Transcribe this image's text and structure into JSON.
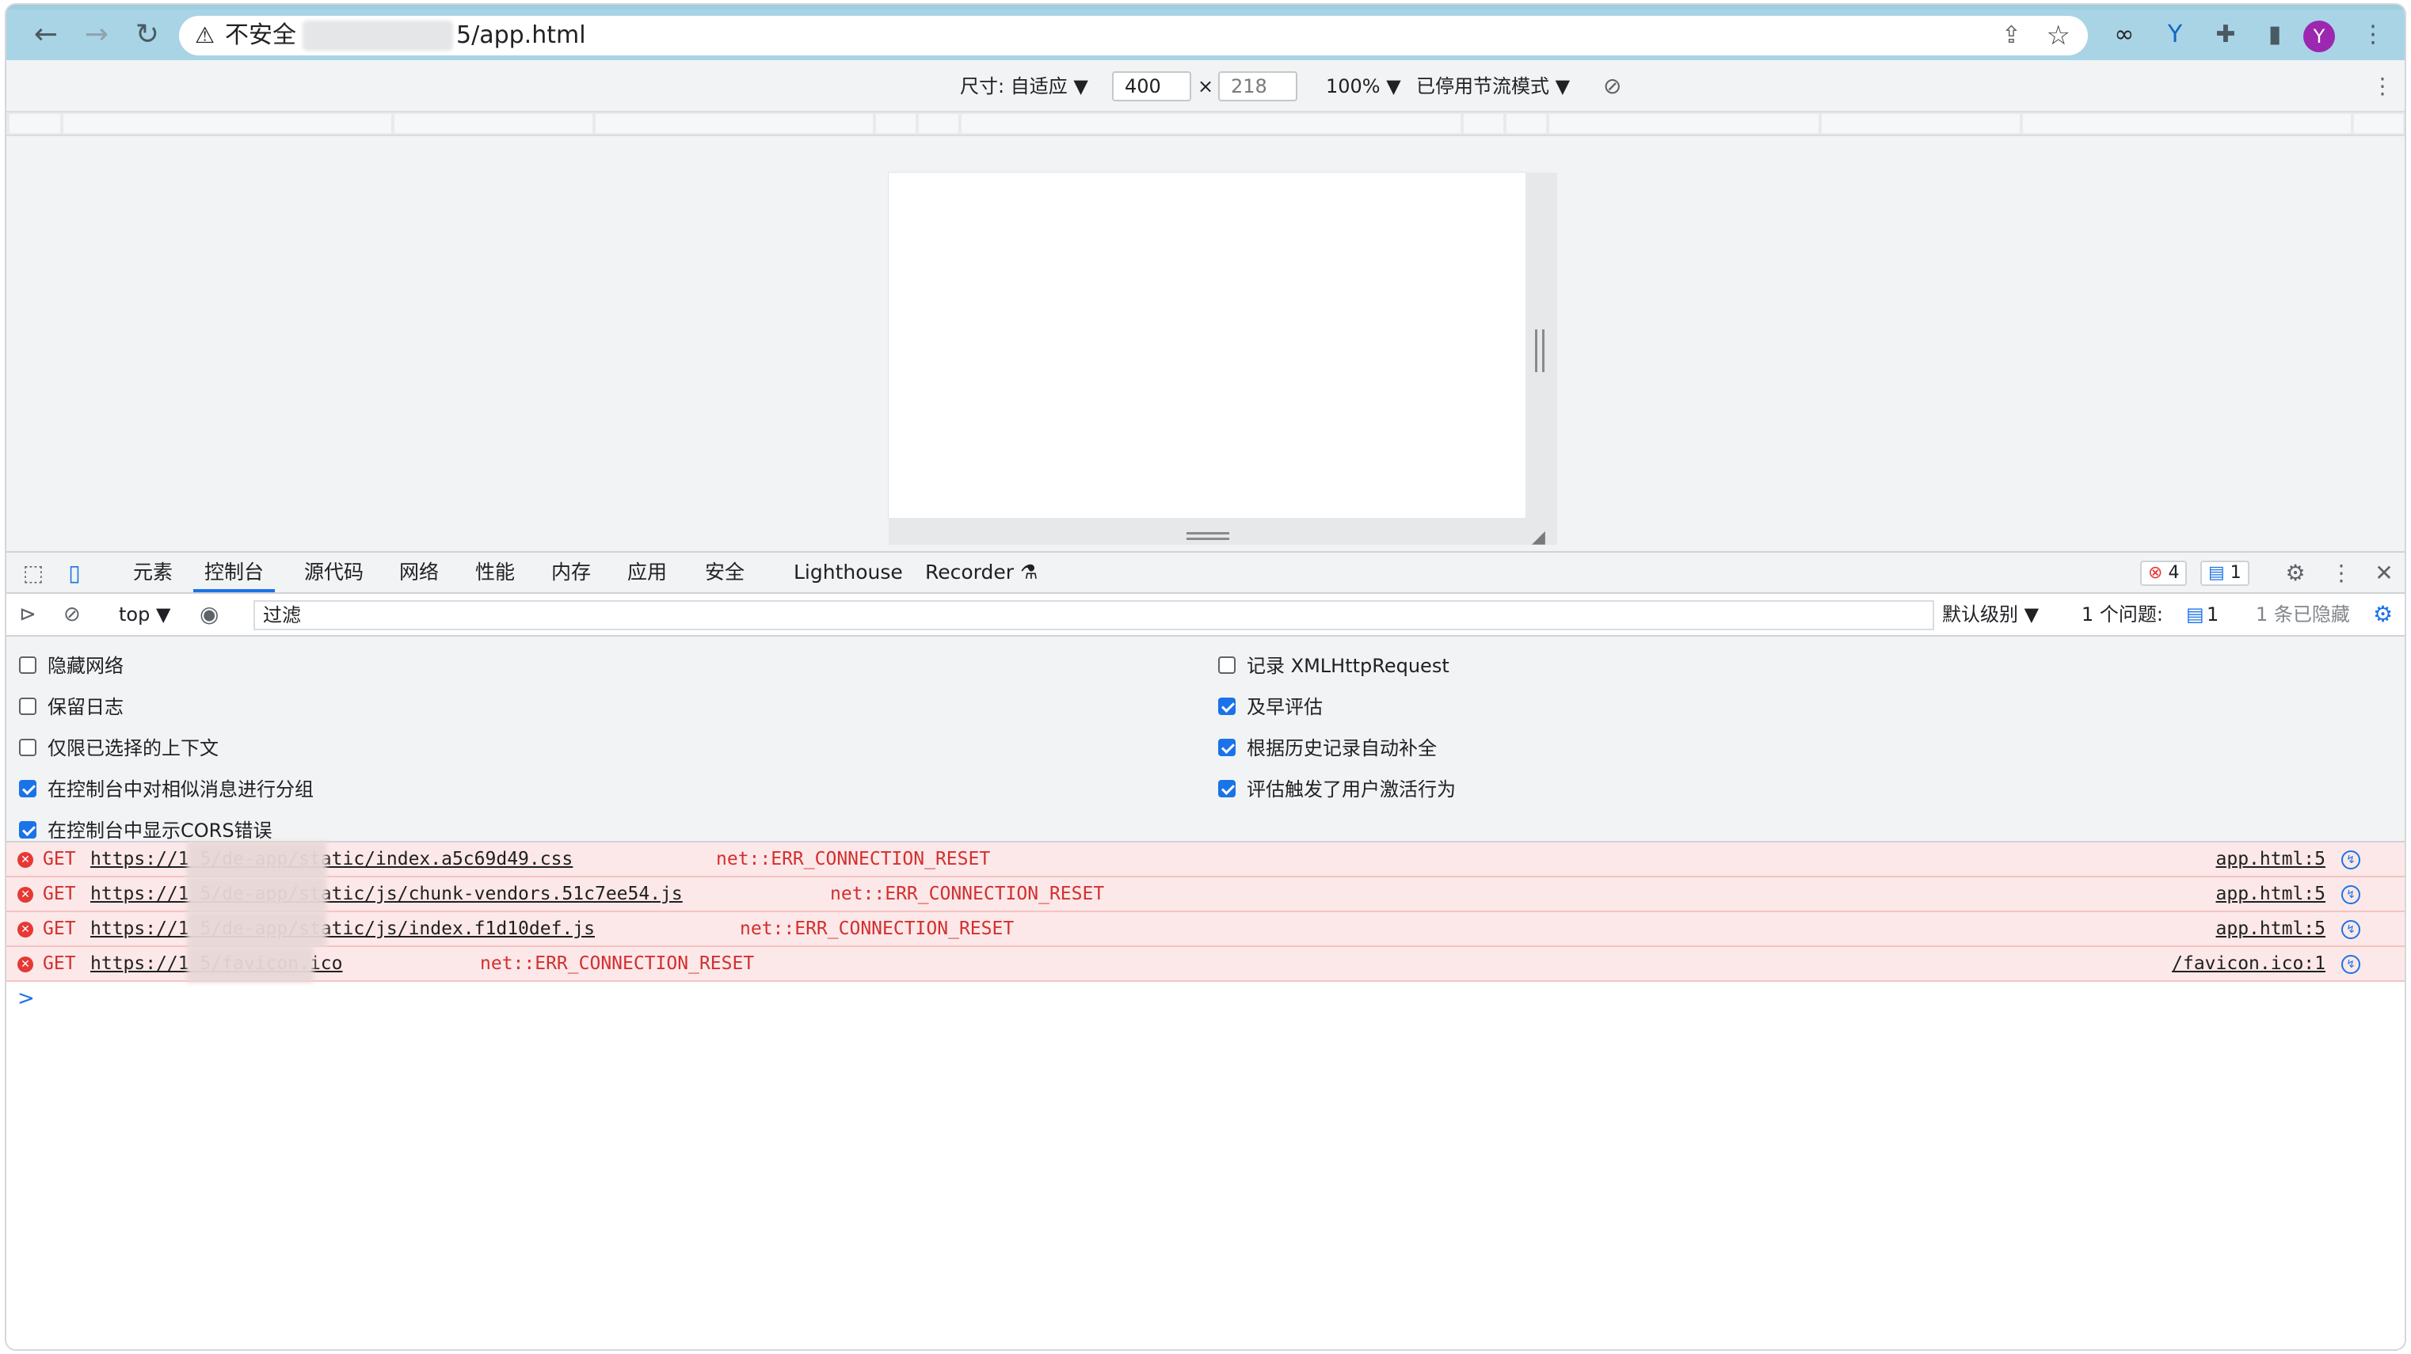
{
  "browser": {
    "security_label": "不安全",
    "url_suffix": "5/app.html",
    "avatar_letter": "Y"
  },
  "device_toolbar": {
    "size_label": "尺寸: 自适应 ▼",
    "width": "400",
    "times": "×",
    "height": "218",
    "zoom": "100% ▼",
    "throttle": "已停用节流模式 ▼"
  },
  "devtools": {
    "tabs": [
      {
        "label": "元素"
      },
      {
        "label": "控制台"
      },
      {
        "label": "源代码"
      },
      {
        "label": "网络"
      },
      {
        "label": "性能"
      },
      {
        "label": "内存"
      },
      {
        "label": "应用"
      },
      {
        "label": "安全"
      },
      {
        "label": "Lighthouse"
      },
      {
        "label": "Recorder ⚗"
      }
    ],
    "active_tab": "控制台",
    "error_count": "4",
    "message_count": "1"
  },
  "console_bar": {
    "context": "top ▼",
    "filter_placeholder": "过滤",
    "level": "默认级别 ▼",
    "issues_label": "1 个问题:",
    "issues_count": "1",
    "hidden_label": "1 条已隐藏"
  },
  "settings": {
    "left": [
      {
        "label": "隐藏网络",
        "checked": false
      },
      {
        "label": "保留日志",
        "checked": false
      },
      {
        "label": "仅限已选择的上下文",
        "checked": false
      },
      {
        "label": "在控制台中对相似消息进行分组",
        "checked": true
      },
      {
        "label": "在控制台中显示CORS错误",
        "checked": true
      }
    ],
    "right": [
      {
        "label": "记录 XMLHttpRequest",
        "checked": false
      },
      {
        "label": "及早评估",
        "checked": true
      },
      {
        "label": "根据历史记录自动补全",
        "checked": true
      },
      {
        "label": "评估触发了用户激活行为",
        "checked": true
      }
    ]
  },
  "errors": [
    {
      "method": "GET",
      "url": "https://1         5/de-app/static/index.a5c69d49.css",
      "code": "net::ERR_CONNECTION_RESET",
      "source": "app.html:5"
    },
    {
      "method": "GET",
      "url": "https://1         5/de-app/static/js/chunk-vendors.51c7ee54.js",
      "code": "net::ERR_CONNECTION_RESET",
      "source": "app.html:5"
    },
    {
      "method": "GET",
      "url": "https://1         5/de-app/static/js/index.f1d10def.js",
      "code": "net::ERR_CONNECTION_RESET",
      "source": "app.html:5"
    },
    {
      "method": "GET",
      "url": "https://1         5/favicon.ico",
      "code": "net::ERR_CONNECTION_RESET",
      "source": "/favicon.ico:1"
    }
  ],
  "prompt_symbol": ">"
}
